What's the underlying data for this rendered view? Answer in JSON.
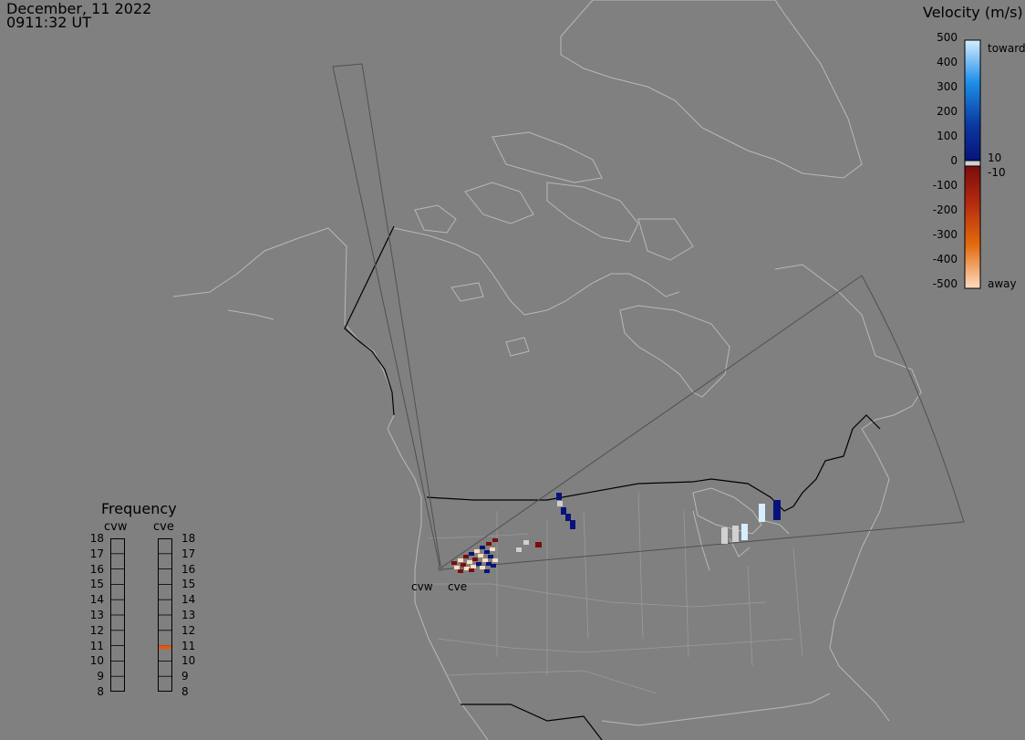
{
  "header": {
    "date": "December, 11 2022",
    "time": "0911:32 UT"
  },
  "colorbar": {
    "title": "Velocity (m/s)",
    "ticks": [
      "500",
      "400",
      "300",
      "200",
      "100",
      "0",
      "-100",
      "-200",
      "-300",
      "-400",
      "-500"
    ],
    "toward_label": "toward",
    "away_label": "away",
    "pos_threshold": "10",
    "neg_threshold": "-10",
    "colors": {
      "toward_light": "#d6eeff",
      "toward_mid": "#1e8ee8",
      "toward_dark": "#08137a",
      "away_dark": "#7a0d0d",
      "away_mid": "#e36c10",
      "away_light": "#fddcc0",
      "ground_scatter": "#d0d0d0"
    }
  },
  "frequency": {
    "title": "Frequency",
    "radars": [
      {
        "name": "cvw",
        "active": null
      },
      {
        "name": "cve",
        "active": 10.9
      }
    ],
    "min": 8,
    "max": 18,
    "labels": [
      "18",
      "17",
      "16",
      "15",
      "14",
      "13",
      "12",
      "11",
      "10",
      "9",
      "8"
    ],
    "active_color": "#e35a10"
  },
  "stations": {
    "cvw": "cvw",
    "cve": "cve"
  },
  "map": {
    "background": "#808080",
    "coast_color": "#b8b8b8",
    "border_color": "#000000",
    "fov_color": "#505050"
  }
}
